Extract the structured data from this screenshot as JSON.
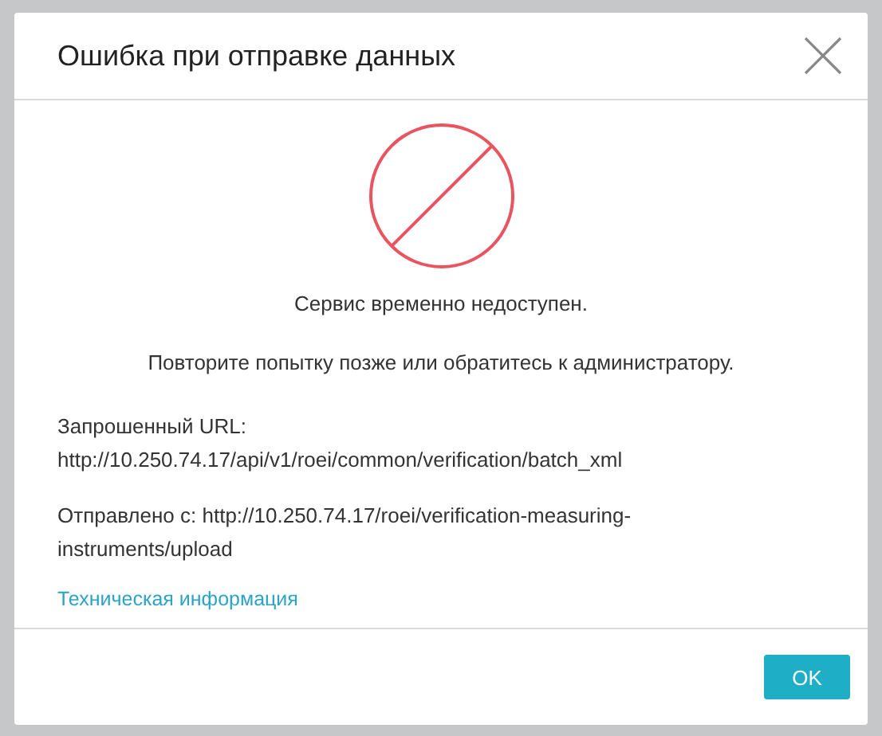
{
  "dialog": {
    "title": "Ошибка при отправке данных",
    "message": "Сервис временно недоступен.",
    "hint": "Повторите попытку позже или обратитесь к администратору.",
    "details": [
      {
        "label": "Запрошенный URL:",
        "value": "http://10.250.74.17/api/v1/roei/common/verification/batch_xml"
      },
      {
        "label": "Отправлено с:",
        "value": "http://10.250.74.17/roei/verification-measuring-instruments/upload"
      }
    ],
    "link": "Техническая информация",
    "buttons": [
      "OK"
    ]
  }
}
